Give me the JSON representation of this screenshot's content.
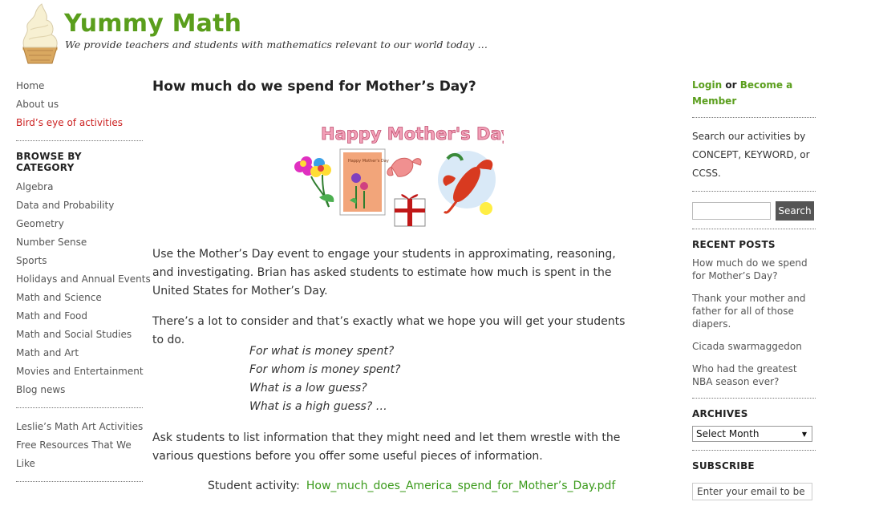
{
  "header": {
    "title": "Yummy Math",
    "tagline": "We provide teachers and students with mathematics relevant to our world today …"
  },
  "left_nav": {
    "top_links": [
      "Home",
      "About us",
      "Bird’s eye of activities"
    ],
    "category_heading": "BROWSE BY CATEGORY",
    "categories": [
      "Algebra",
      "Data and Probability",
      "Geometry",
      "Number Sense",
      "Sports",
      "Holidays and Annual Events",
      "Math and Science",
      "Math and Food",
      "Math and Social Studies",
      "Math and Art",
      "Movies and Entertainment",
      "Blog news"
    ],
    "extra_links": [
      "Leslie’s Math Art Activities",
      "Free Resources That We",
      "Like"
    ]
  },
  "post": {
    "title": "How much do we spend for Mother’s Day?",
    "image_banner": "Happy Mother's Day",
    "card_text": "Happy Mother's Day",
    "p1": "Use the Mother’s Day event to engage your students in approximating, reasoning, and investigating.  Brian has asked students to estimate how much is spent in the United States for Mother’s Day.",
    "p2": "There’s a lot to consider and that’s exactly what we hope you will get your students to do.",
    "questions": [
      "For what is money spent?",
      "For whom is money spent?",
      "What is a low guess?",
      "What is a high guess? …"
    ],
    "p3": "Ask students to list information that they might need and let them wrestle with the various questions before you offer some useful pieces of information.",
    "activity_label": "Student activity:",
    "activity_link": "How_much_does_America_spend_for_Mother’s_Day.pdf"
  },
  "right": {
    "login": "Login",
    "or": "or",
    "become_member": "Become a Member",
    "search_help": "Search our activities by CONCEPT, KEYWORD, or CCSS.",
    "search_button": "Search",
    "recent_heading": "RECENT POSTS",
    "recent_posts": [
      "How much do we spend for Mother’s Day?",
      "Thank your mother and father for all of those diapers.",
      "Cicada swarmaggedon",
      "Who had the greatest NBA season ever?"
    ],
    "archives_heading": "ARCHIVES",
    "archives_selected": "Select Month",
    "subscribe_heading": "SUBSCRIBE",
    "email_placeholder": "Enter your email to be"
  },
  "colors": {
    "brand_green": "#5a9e1c",
    "hot_link": "#cc2222",
    "link_green": "#3a9a1a"
  }
}
